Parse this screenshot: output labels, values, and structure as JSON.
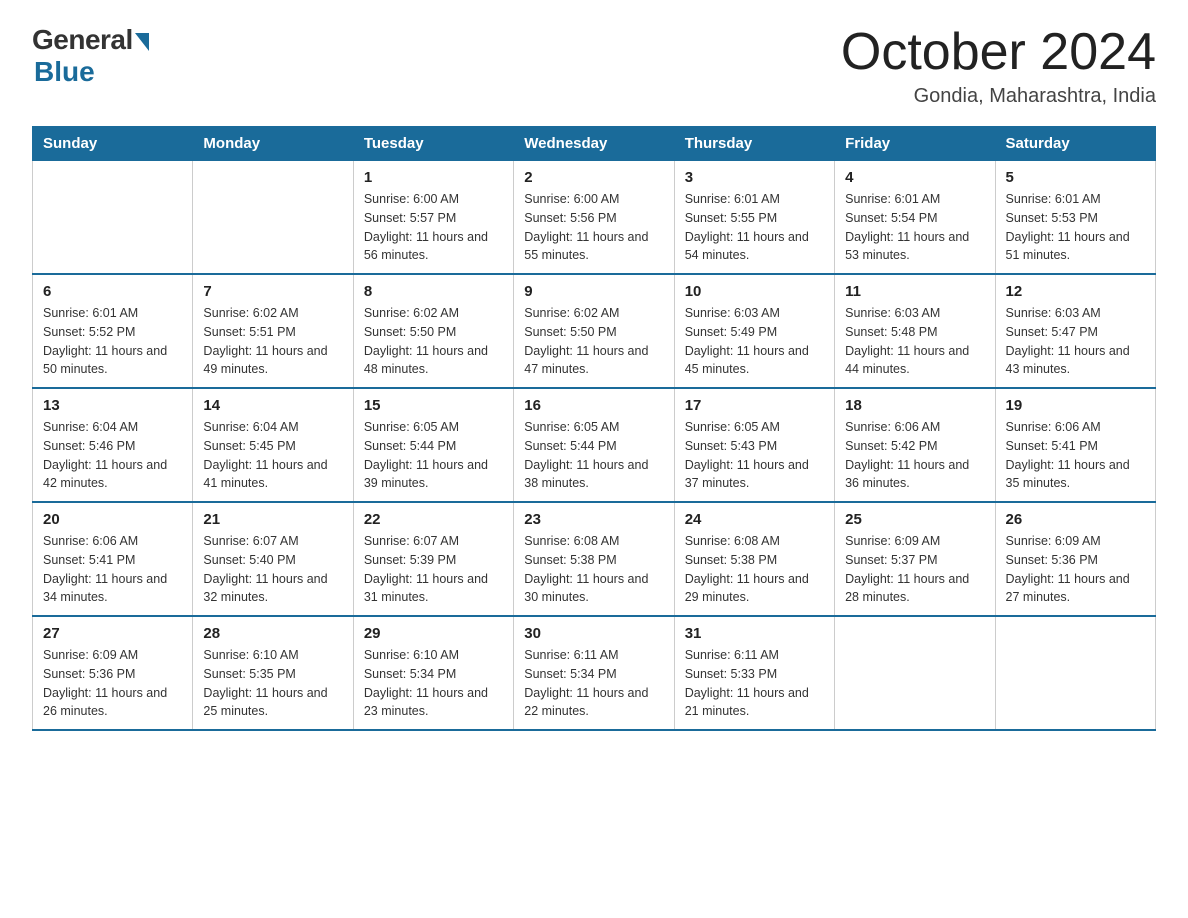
{
  "logo": {
    "general": "General",
    "blue": "Blue",
    "subtitle": "Blue"
  },
  "header": {
    "month": "October 2024",
    "location": "Gondia, Maharashtra, India"
  },
  "days_of_week": [
    "Sunday",
    "Monday",
    "Tuesday",
    "Wednesday",
    "Thursday",
    "Friday",
    "Saturday"
  ],
  "weeks": [
    [
      {
        "day": "",
        "sunrise": "",
        "sunset": "",
        "daylight": ""
      },
      {
        "day": "",
        "sunrise": "",
        "sunset": "",
        "daylight": ""
      },
      {
        "day": "1",
        "sunrise": "Sunrise: 6:00 AM",
        "sunset": "Sunset: 5:57 PM",
        "daylight": "Daylight: 11 hours and 56 minutes."
      },
      {
        "day": "2",
        "sunrise": "Sunrise: 6:00 AM",
        "sunset": "Sunset: 5:56 PM",
        "daylight": "Daylight: 11 hours and 55 minutes."
      },
      {
        "day": "3",
        "sunrise": "Sunrise: 6:01 AM",
        "sunset": "Sunset: 5:55 PM",
        "daylight": "Daylight: 11 hours and 54 minutes."
      },
      {
        "day": "4",
        "sunrise": "Sunrise: 6:01 AM",
        "sunset": "Sunset: 5:54 PM",
        "daylight": "Daylight: 11 hours and 53 minutes."
      },
      {
        "day": "5",
        "sunrise": "Sunrise: 6:01 AM",
        "sunset": "Sunset: 5:53 PM",
        "daylight": "Daylight: 11 hours and 51 minutes."
      }
    ],
    [
      {
        "day": "6",
        "sunrise": "Sunrise: 6:01 AM",
        "sunset": "Sunset: 5:52 PM",
        "daylight": "Daylight: 11 hours and 50 minutes."
      },
      {
        "day": "7",
        "sunrise": "Sunrise: 6:02 AM",
        "sunset": "Sunset: 5:51 PM",
        "daylight": "Daylight: 11 hours and 49 minutes."
      },
      {
        "day": "8",
        "sunrise": "Sunrise: 6:02 AM",
        "sunset": "Sunset: 5:50 PM",
        "daylight": "Daylight: 11 hours and 48 minutes."
      },
      {
        "day": "9",
        "sunrise": "Sunrise: 6:02 AM",
        "sunset": "Sunset: 5:50 PM",
        "daylight": "Daylight: 11 hours and 47 minutes."
      },
      {
        "day": "10",
        "sunrise": "Sunrise: 6:03 AM",
        "sunset": "Sunset: 5:49 PM",
        "daylight": "Daylight: 11 hours and 45 minutes."
      },
      {
        "day": "11",
        "sunrise": "Sunrise: 6:03 AM",
        "sunset": "Sunset: 5:48 PM",
        "daylight": "Daylight: 11 hours and 44 minutes."
      },
      {
        "day": "12",
        "sunrise": "Sunrise: 6:03 AM",
        "sunset": "Sunset: 5:47 PM",
        "daylight": "Daylight: 11 hours and 43 minutes."
      }
    ],
    [
      {
        "day": "13",
        "sunrise": "Sunrise: 6:04 AM",
        "sunset": "Sunset: 5:46 PM",
        "daylight": "Daylight: 11 hours and 42 minutes."
      },
      {
        "day": "14",
        "sunrise": "Sunrise: 6:04 AM",
        "sunset": "Sunset: 5:45 PM",
        "daylight": "Daylight: 11 hours and 41 minutes."
      },
      {
        "day": "15",
        "sunrise": "Sunrise: 6:05 AM",
        "sunset": "Sunset: 5:44 PM",
        "daylight": "Daylight: 11 hours and 39 minutes."
      },
      {
        "day": "16",
        "sunrise": "Sunrise: 6:05 AM",
        "sunset": "Sunset: 5:44 PM",
        "daylight": "Daylight: 11 hours and 38 minutes."
      },
      {
        "day": "17",
        "sunrise": "Sunrise: 6:05 AM",
        "sunset": "Sunset: 5:43 PM",
        "daylight": "Daylight: 11 hours and 37 minutes."
      },
      {
        "day": "18",
        "sunrise": "Sunrise: 6:06 AM",
        "sunset": "Sunset: 5:42 PM",
        "daylight": "Daylight: 11 hours and 36 minutes."
      },
      {
        "day": "19",
        "sunrise": "Sunrise: 6:06 AM",
        "sunset": "Sunset: 5:41 PM",
        "daylight": "Daylight: 11 hours and 35 minutes."
      }
    ],
    [
      {
        "day": "20",
        "sunrise": "Sunrise: 6:06 AM",
        "sunset": "Sunset: 5:41 PM",
        "daylight": "Daylight: 11 hours and 34 minutes."
      },
      {
        "day": "21",
        "sunrise": "Sunrise: 6:07 AM",
        "sunset": "Sunset: 5:40 PM",
        "daylight": "Daylight: 11 hours and 32 minutes."
      },
      {
        "day": "22",
        "sunrise": "Sunrise: 6:07 AM",
        "sunset": "Sunset: 5:39 PM",
        "daylight": "Daylight: 11 hours and 31 minutes."
      },
      {
        "day": "23",
        "sunrise": "Sunrise: 6:08 AM",
        "sunset": "Sunset: 5:38 PM",
        "daylight": "Daylight: 11 hours and 30 minutes."
      },
      {
        "day": "24",
        "sunrise": "Sunrise: 6:08 AM",
        "sunset": "Sunset: 5:38 PM",
        "daylight": "Daylight: 11 hours and 29 minutes."
      },
      {
        "day": "25",
        "sunrise": "Sunrise: 6:09 AM",
        "sunset": "Sunset: 5:37 PM",
        "daylight": "Daylight: 11 hours and 28 minutes."
      },
      {
        "day": "26",
        "sunrise": "Sunrise: 6:09 AM",
        "sunset": "Sunset: 5:36 PM",
        "daylight": "Daylight: 11 hours and 27 minutes."
      }
    ],
    [
      {
        "day": "27",
        "sunrise": "Sunrise: 6:09 AM",
        "sunset": "Sunset: 5:36 PM",
        "daylight": "Daylight: 11 hours and 26 minutes."
      },
      {
        "day": "28",
        "sunrise": "Sunrise: 6:10 AM",
        "sunset": "Sunset: 5:35 PM",
        "daylight": "Daylight: 11 hours and 25 minutes."
      },
      {
        "day": "29",
        "sunrise": "Sunrise: 6:10 AM",
        "sunset": "Sunset: 5:34 PM",
        "daylight": "Daylight: 11 hours and 23 minutes."
      },
      {
        "day": "30",
        "sunrise": "Sunrise: 6:11 AM",
        "sunset": "Sunset: 5:34 PM",
        "daylight": "Daylight: 11 hours and 22 minutes."
      },
      {
        "day": "31",
        "sunrise": "Sunrise: 6:11 AM",
        "sunset": "Sunset: 5:33 PM",
        "daylight": "Daylight: 11 hours and 21 minutes."
      },
      {
        "day": "",
        "sunrise": "",
        "sunset": "",
        "daylight": ""
      },
      {
        "day": "",
        "sunrise": "",
        "sunset": "",
        "daylight": ""
      }
    ]
  ]
}
